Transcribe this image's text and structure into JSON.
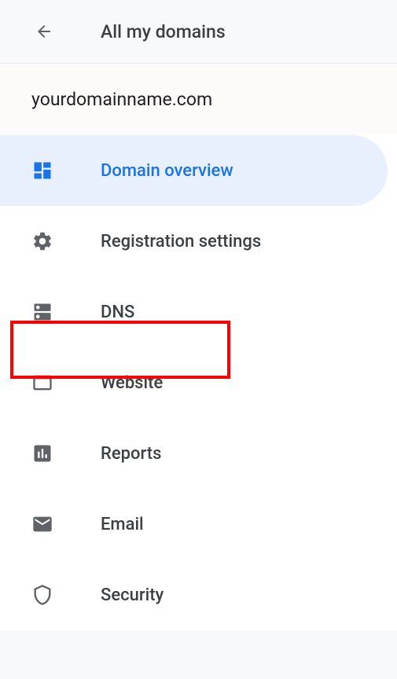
{
  "header": {
    "title": "All my domains"
  },
  "domain": {
    "name": "yourdomainname.com"
  },
  "nav": {
    "items": [
      {
        "label": "Domain overview",
        "active": true
      },
      {
        "label": "Registration settings",
        "active": false
      },
      {
        "label": "DNS",
        "active": false
      },
      {
        "label": "Website",
        "active": false
      },
      {
        "label": "Reports",
        "active": false
      },
      {
        "label": "Email",
        "active": false
      },
      {
        "label": "Security",
        "active": false
      }
    ]
  }
}
